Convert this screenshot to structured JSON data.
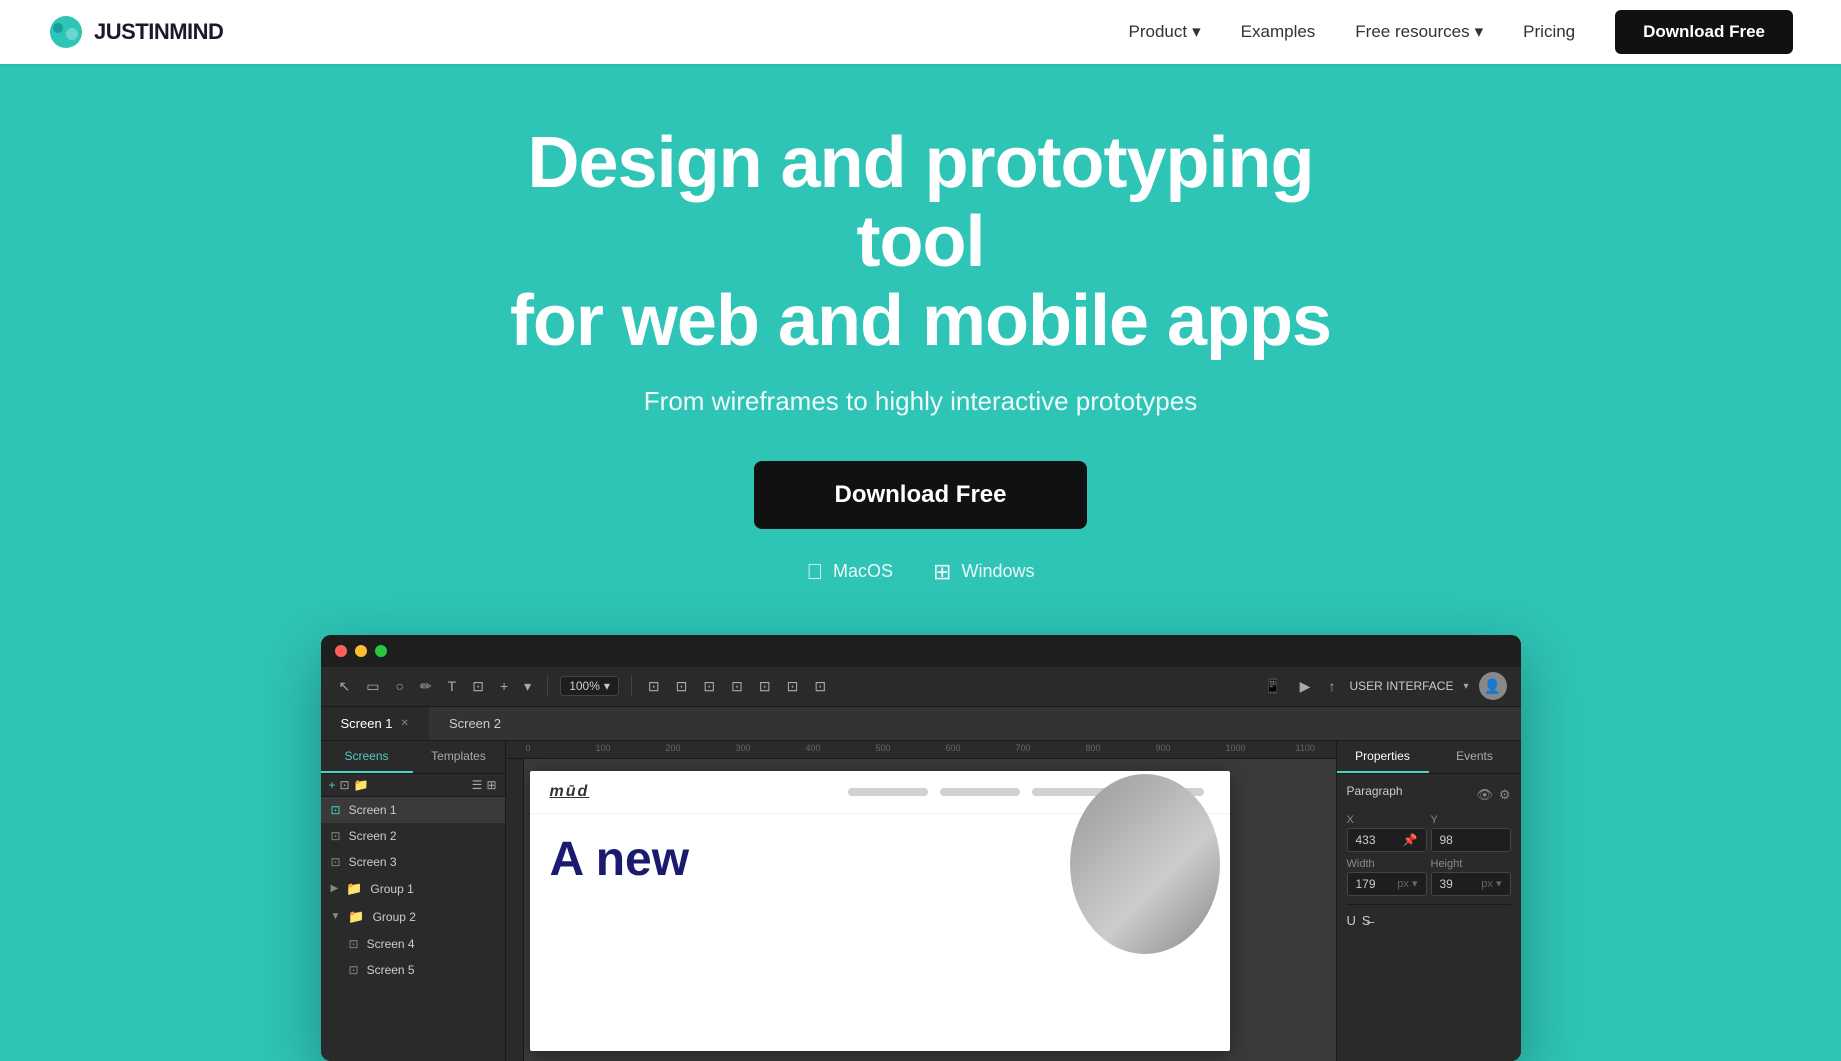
{
  "nav": {
    "logo_text": "JUSTINMIND",
    "links": [
      {
        "label": "Product",
        "has_dropdown": true
      },
      {
        "label": "Examples",
        "has_dropdown": false
      },
      {
        "label": "Free resources",
        "has_dropdown": true
      },
      {
        "label": "Pricing",
        "has_dropdown": false
      }
    ],
    "cta_label": "Download Free"
  },
  "hero": {
    "title_line1": "Design and prototyping tool",
    "title_line2": "for web and mobile apps",
    "subtitle": "From wireframes to highly interactive prototypes",
    "cta_label": "Download Free",
    "platforms": [
      {
        "icon": "",
        "label": "MacOS"
      },
      {
        "icon": "⊞",
        "label": "Windows"
      }
    ]
  },
  "app": {
    "tabs": [
      {
        "label": "Screen 1",
        "active": true
      },
      {
        "label": "Screen 2",
        "active": false
      }
    ],
    "zoom": "100%",
    "ui_label": "USER INTERFACE",
    "left_panel": {
      "tabs": [
        "Screens",
        "Templates"
      ],
      "active_tab": "Screens",
      "screens": [
        {
          "label": "Screen 1",
          "type": "screen",
          "active": true
        },
        {
          "label": "Screen 2",
          "type": "screen"
        },
        {
          "label": "Screen 3",
          "type": "screen"
        },
        {
          "label": "Group 1",
          "type": "group"
        },
        {
          "label": "Group 2",
          "type": "group",
          "expanded": true
        },
        {
          "label": "Screen 4",
          "type": "screen",
          "indent": true
        },
        {
          "label": "Screen 5",
          "type": "screen",
          "indent": true
        }
      ]
    },
    "right_panel": {
      "tabs": [
        "Properties",
        "Events"
      ],
      "active_tab": "Properties",
      "element_type": "Paragraph",
      "x": "433",
      "y": "98",
      "width": "179",
      "height": "39"
    },
    "canvas": {
      "ruler_marks": [
        "0",
        "100",
        "200",
        "300",
        "400",
        "500",
        "600",
        "700",
        "800",
        "900",
        "1000",
        "1100"
      ],
      "prototype": {
        "logo": "mūd",
        "title": "A new"
      }
    }
  }
}
